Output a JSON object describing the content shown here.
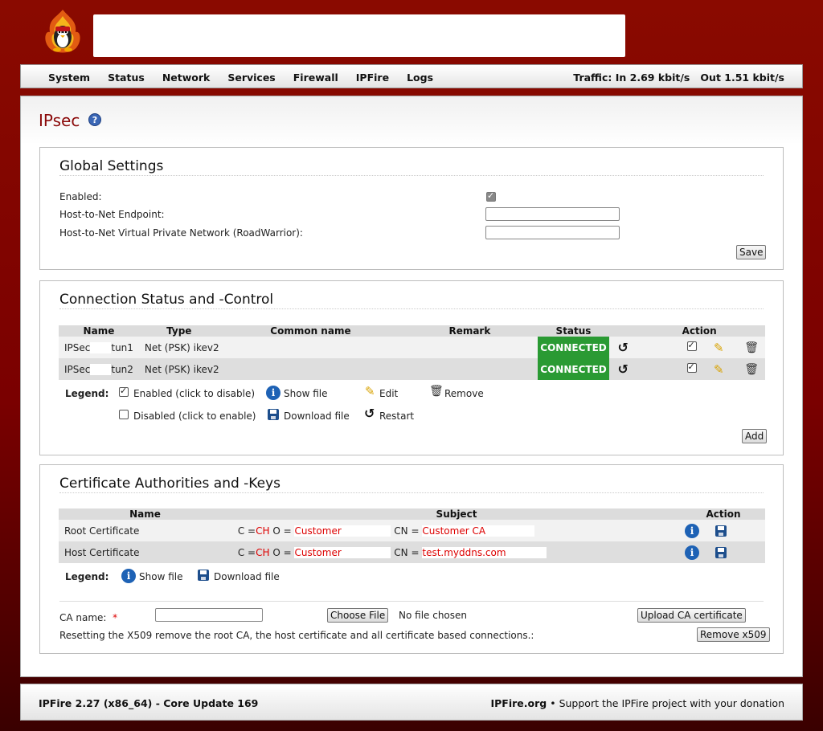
{
  "header": {
    "logo_icon": "ipfire-penguin-flame-logo",
    "menu": [
      "System",
      "Status",
      "Network",
      "Services",
      "Firewall",
      "IPFire",
      "Logs"
    ],
    "traffic": "Traffic: In 2.69 kbit/s   Out 1.51 kbit/s"
  },
  "page": {
    "title": "IPsec",
    "help_icon": "help-icon"
  },
  "global_settings": {
    "heading": "Global Settings",
    "enabled_label": "Enabled:",
    "enabled": true,
    "endpoint_label": "Host-to-Net Endpoint:",
    "endpoint_value": "",
    "vpn_label": "Host-to-Net Virtual Private Network (RoadWarrior):",
    "vpn_value": "",
    "save_button": "Save"
  },
  "connections": {
    "heading": "Connection Status and -Control",
    "columns": [
      "Name",
      "Type",
      "Common name",
      "Remark",
      "Status",
      "Action"
    ],
    "rows": [
      {
        "name_prefix": "IPSec",
        "name_suffix": "tun1",
        "type": "Net (PSK) ikev2",
        "common_name": "",
        "remark": "",
        "status": "CONNECTED"
      },
      {
        "name_prefix": "IPSec",
        "name_suffix": "tun2",
        "type": "Net (PSK) ikev2",
        "common_name": "",
        "remark": "",
        "status": "CONNECTED"
      }
    ],
    "status_color": "#2a9a33",
    "legend": {
      "label": "Legend:",
      "enabled": "Enabled (click to disable)",
      "show_file": "Show file",
      "edit": "Edit",
      "remove": "Remove",
      "disabled": "Disabled (click to enable)",
      "download_file": "Download file",
      "restart": "Restart"
    },
    "add_button": "Add"
  },
  "certificates": {
    "heading": "Certificate Authorities and -Keys",
    "columns": [
      "Name",
      "Subject",
      "Action"
    ],
    "rows": [
      {
        "name": "Root Certificate",
        "c_label": "C =",
        "c": "CH",
        "o_label": "O =",
        "o": "Customer",
        "cn_label": "CN =",
        "cn": "Customer CA"
      },
      {
        "name": "Host Certificate",
        "c_label": "C =",
        "c": "CH",
        "o_label": "O =",
        "o": "Customer",
        "cn_label": "CN =",
        "cn": "test.myddns.com"
      }
    ],
    "legend": {
      "label": "Legend:",
      "show_file": "Show file",
      "download_file": "Download file"
    },
    "ca_name_label": "CA name:",
    "required_mark": "*",
    "ca_name_value": "",
    "choose_file_button": "Choose File",
    "no_file_text": "No file chosen",
    "upload_button": "Upload CA certificate",
    "reset_text": "Resetting the X509 remove the root CA, the host certificate and all certificate based connections.:",
    "remove_button": "Remove x509"
  },
  "footer": {
    "version": "IPFire 2.27 (x86_64) - Core Update 169",
    "site": "IPFire.org",
    "support": "• Support the IPFire project with your donation"
  }
}
